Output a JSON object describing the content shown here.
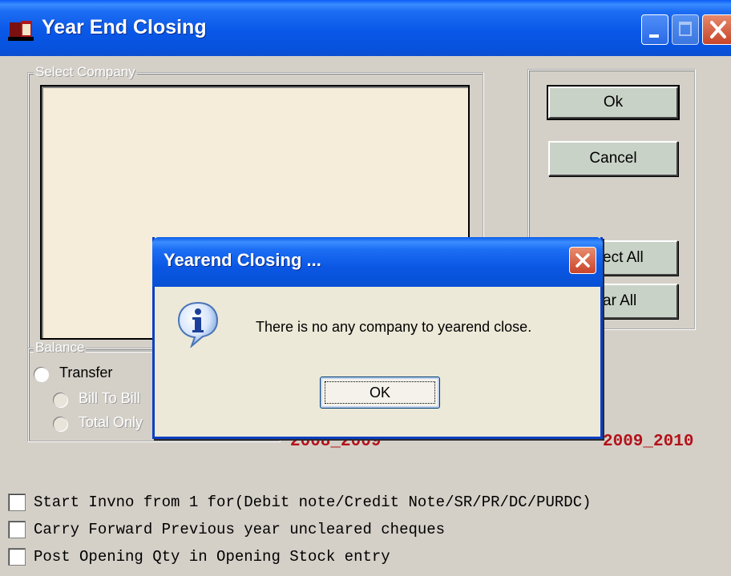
{
  "window": {
    "title": "Year End Closing"
  },
  "select_company": {
    "legend": "Select Company"
  },
  "buttons": {
    "ok": "Ok",
    "cancel": "Cancel",
    "select_all_partial": "ect All",
    "clear_all_partial": "ar All"
  },
  "balance": {
    "legend": "Balance",
    "transfer": "Transfer",
    "bill_to_bill": "Bill To Bill",
    "total_only": "Total Only"
  },
  "years": {
    "from": "2008_2009",
    "to": "2009_2010"
  },
  "options": [
    {
      "label": "Start Invno from 1 for(Debit note/Credit Note/SR/PR/DC/PURDC)",
      "checked": false
    },
    {
      "label": "Carry Forward Previous year uncleared cheques",
      "checked": false
    },
    {
      "label": "Post Opening Qty in Opening Stock entry",
      "checked": false
    }
  ],
  "dialog": {
    "title": "Yearend Closing ...",
    "message": "There is no any company to yearend close.",
    "ok": "OK",
    "icon": "info-icon"
  },
  "colors": {
    "title_bar": "#0a58e8",
    "year_text": "#b3121a",
    "list_background": "#f5ecd9"
  }
}
